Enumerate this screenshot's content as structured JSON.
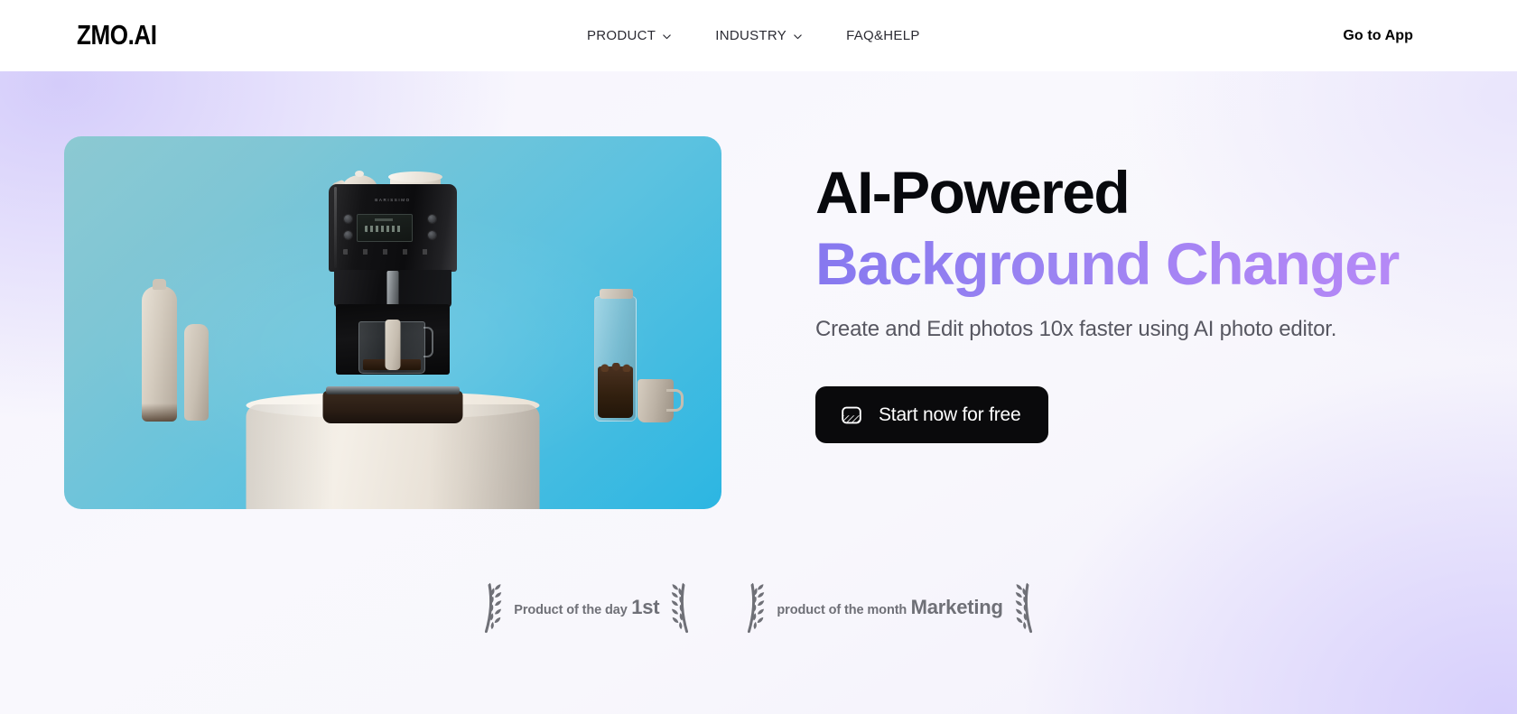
{
  "header": {
    "logo": "ZMO.AI",
    "nav_items": [
      {
        "label": "PRODUCT",
        "has_dropdown": true,
        "icon": "chevron-down-icon"
      },
      {
        "label": "INDUSTRY",
        "has_dropdown": true,
        "icon": "chevron-down-icon"
      },
      {
        "label": "FAQ&HELP",
        "has_dropdown": false,
        "icon": ""
      }
    ],
    "cta": "Go to App"
  },
  "hero": {
    "image": {
      "alt": "coffee machine on pedestal with cyan background",
      "background_gradient_from": "#8cc9d2",
      "background_gradient_to": "#2cb6e2",
      "machine_brand": "BARISSIMO"
    },
    "headline_line1": "AI-Powered",
    "headline_line2": "Background Changer",
    "headline_gradient_from": "#8678ef",
    "headline_gradient_to": "#b98bf6",
    "subheadline": "Create and Edit photos 10x faster using AI photo editor.",
    "cta_button": {
      "label": "Start now for free",
      "icon": "replace-background-icon",
      "background": "#0a0a0c",
      "text_color": "#ffffff"
    }
  },
  "awards": [
    {
      "icon_left": "laurel-wreath-icon",
      "icon_right": "laurel-wreath-icon",
      "line1": "Product of the day",
      "line2": "1st"
    },
    {
      "icon_left": "laurel-wreath-icon",
      "icon_right": "laurel-wreath-icon",
      "line1": "product of the month",
      "line2": "Marketing"
    }
  ],
  "theme": {
    "page_background_tint": "#e6e2fb",
    "page_background_center": "#f8f7fc",
    "accent_purple": "#9a83f2",
    "text_primary": "#08090d",
    "text_secondary": "#575761",
    "text_muted": "#6f7077"
  }
}
